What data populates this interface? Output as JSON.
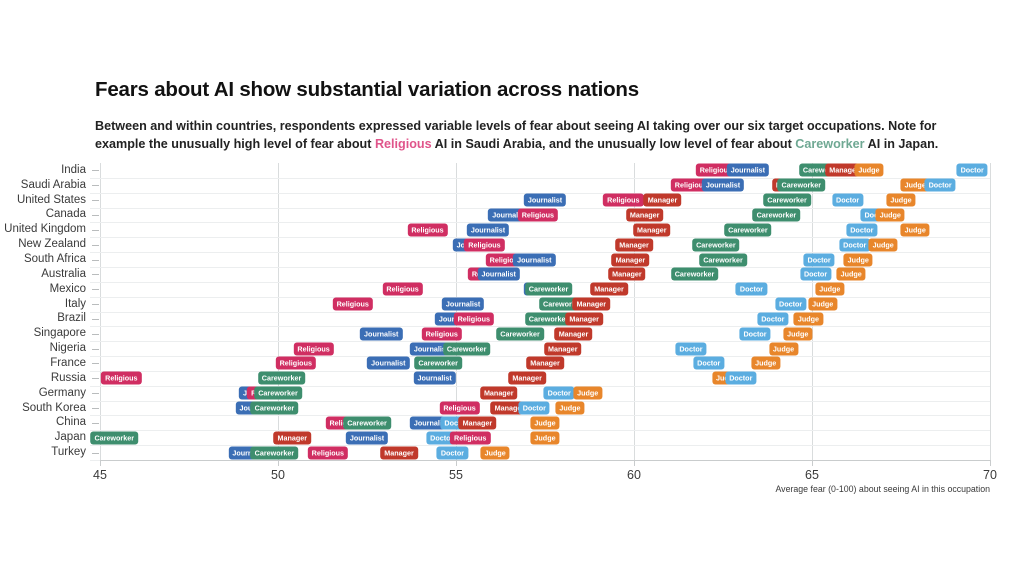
{
  "header": {
    "title": "Fears about AI show substantial variation across nations",
    "subtitle_part1": "Between and within countries, respondents expressed variable levels of fear about seeing AI taking over our six target occupations. Note for example the unusually high level of fear about ",
    "subtitle_hl1": "Religious",
    "subtitle_part2": " AI in Saudi Arabia, and the unusually low level of fear about ",
    "subtitle_hl2": "Careworker",
    "subtitle_part3": " AI in Japan."
  },
  "colors": {
    "religious": "#D02E62",
    "journalist": "#3B6EB5",
    "careworker": "#3E8E6E",
    "manager": "#C0392B",
    "judge": "#E8862B",
    "doctor": "#5BADE0",
    "highlight_religious": "#E0558B",
    "highlight_careworker": "#6FA893",
    "grid": "#e8eaeb",
    "axis": "#c9cccd"
  },
  "chart_data": {
    "type": "scatter",
    "title": "Fears about AI show substantial variation across nations",
    "xlabel": "Average fear (0-100) about seeing AI in this occupation",
    "ylabel": "",
    "xlim": [
      45,
      70
    ],
    "xticks": [
      45,
      50,
      55,
      60,
      65,
      70
    ],
    "grid": true,
    "legend": "none",
    "occupations": [
      "Religious",
      "Journalist",
      "Careworker",
      "Manager",
      "Judge",
      "Doctor"
    ],
    "categories": [
      "India",
      "Saudi Arabia",
      "United States",
      "Canada",
      "United Kingdom",
      "New Zealand",
      "South Africa",
      "Australia",
      "Mexico",
      "Italy",
      "Brazil",
      "Singapore",
      "Nigeria",
      "France",
      "Russia",
      "Germany",
      "South Korea",
      "China",
      "Japan",
      "Turkey"
    ],
    "series": [
      {
        "name": "Religious",
        "values": [
          62.3,
          61.6,
          59.7,
          57.3,
          54.2,
          55.8,
          56.4,
          55.9,
          53.5,
          52.1,
          55.5,
          54.6,
          51.0,
          50.5,
          45.6,
          49.7,
          55.1,
          51.9,
          55.4,
          51.4
        ]
      },
      {
        "name": "Journalist",
        "values": [
          63.2,
          62.5,
          57.5,
          56.5,
          55.9,
          55.5,
          57.2,
          56.2,
          57.5,
          55.2,
          55.0,
          52.9,
          54.3,
          53.1,
          54.4,
          49.5,
          49.4,
          54.3,
          52.5,
          49.2
        ]
      },
      {
        "name": "Careworker",
        "values": [
          65.3,
          64.7,
          64.3,
          64.0,
          63.2,
          62.3,
          62.5,
          61.7,
          57.6,
          58.0,
          57.6,
          56.8,
          55.3,
          54.5,
          50.1,
          50.0,
          49.9,
          52.5,
          45.4,
          49.9
        ]
      },
      {
        "name": "Manager",
        "values": [
          65.9,
          64.4,
          60.8,
          60.3,
          60.5,
          60.0,
          59.9,
          59.8,
          59.3,
          58.8,
          58.6,
          58.3,
          58.0,
          57.5,
          57.0,
          56.2,
          56.5,
          55.6,
          50.4,
          53.4
        ]
      },
      {
        "name": "Judge",
        "values": [
          66.6,
          67.9,
          67.5,
          67.2,
          67.9,
          67.0,
          66.3,
          66.1,
          65.5,
          65.3,
          64.9,
          64.6,
          64.2,
          63.7,
          62.6,
          58.7,
          58.2,
          57.5,
          57.5,
          56.1
        ]
      },
      {
        "name": "Doctor",
        "values": [
          69.5,
          68.6,
          66.0,
          66.8,
          66.4,
          66.2,
          65.2,
          65.1,
          63.3,
          64.4,
          63.9,
          63.4,
          61.6,
          62.1,
          63.0,
          57.9,
          57.2,
          55.0,
          54.6,
          54.9
        ]
      }
    ]
  }
}
